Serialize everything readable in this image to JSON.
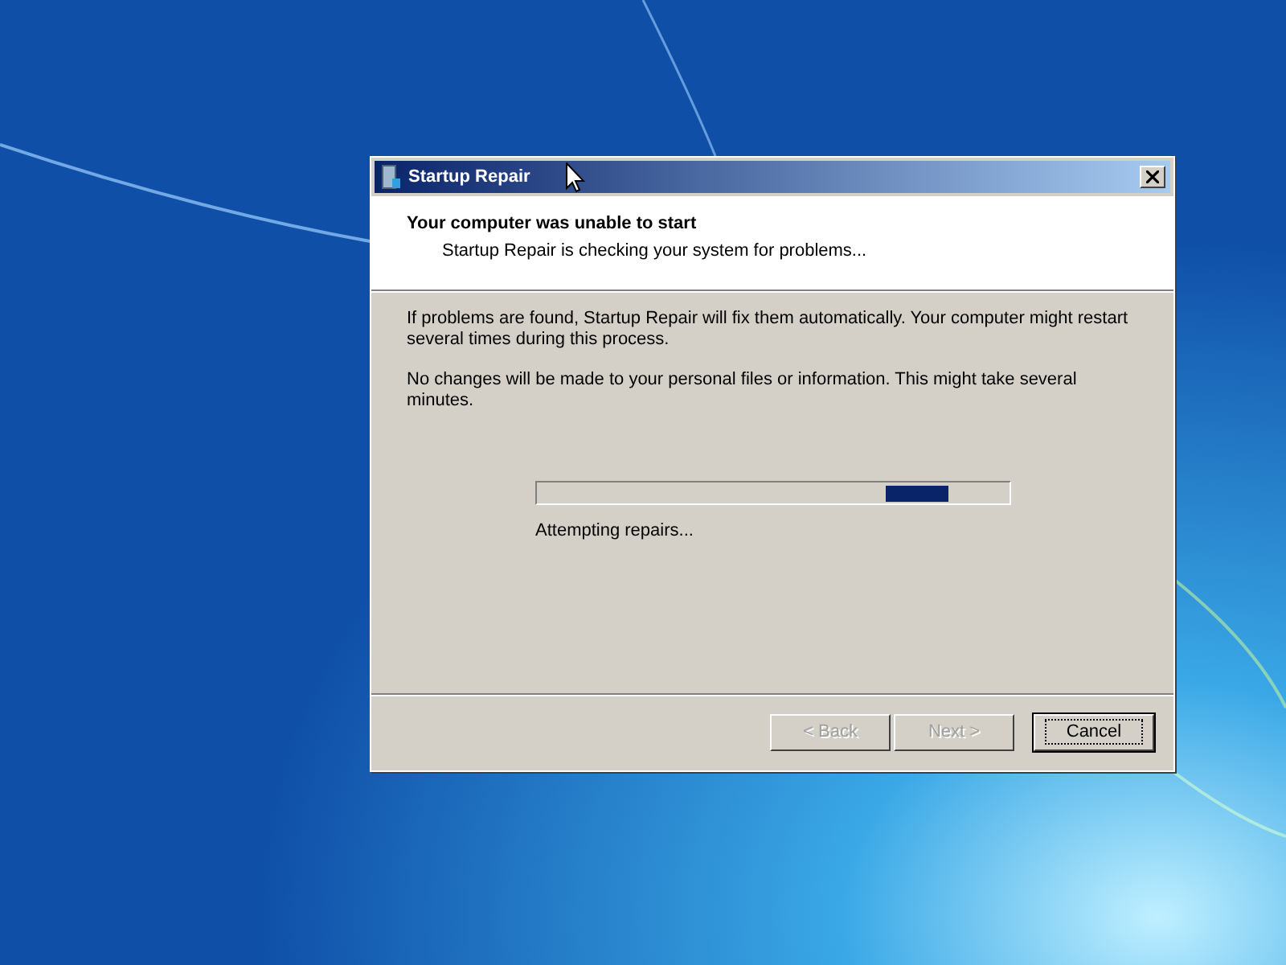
{
  "window": {
    "title": "Startup Repair"
  },
  "header": {
    "title": "Your computer was unable to start",
    "subtitle": "Startup Repair is checking your system for problems..."
  },
  "paragraphs": [
    "If problems are found, Startup Repair will fix them automatically. Your computer might restart several times during this process.",
    "No changes will be made to your personal files or information. This might take several minutes."
  ],
  "progress": {
    "level": 0.87,
    "status": "Attempting repairs..."
  },
  "buttons": [
    {
      "label": "< Back",
      "disabled": true,
      "default": false
    },
    {
      "label": "Next >",
      "disabled": true,
      "default": false
    },
    {
      "label": "Cancel",
      "disabled": false,
      "default": true
    }
  ]
}
